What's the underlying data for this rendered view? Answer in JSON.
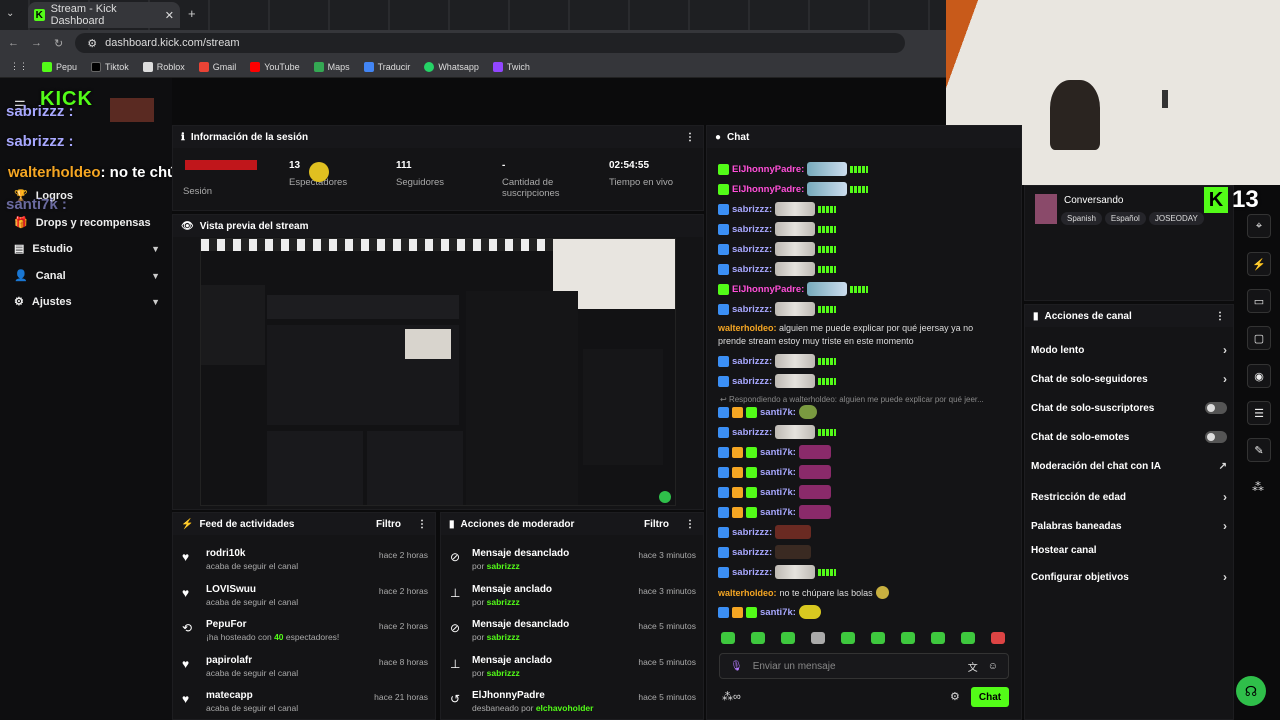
{
  "browser": {
    "tab_title": "Stream - Kick Dashboard",
    "url": "dashboard.kick.com/stream",
    "bookmarks": [
      "Pepu",
      "Tiktok",
      "Roblox",
      "Gmail",
      "YouTube",
      "Maps",
      "Traducir",
      "Whatsapp",
      "Twich"
    ]
  },
  "overlay": {
    "logo": "KICK",
    "lines": [
      {
        "user": "sabrizzz",
        "text": ":"
      },
      {
        "user": "sabrizzz",
        "text": ":"
      },
      {
        "user": "walterholdeo",
        "text": ": no te chúpare las bolas"
      },
      {
        "user": "santi7k",
        "text": ":"
      }
    ]
  },
  "sidebar": {
    "items": [
      {
        "label": "Logros"
      },
      {
        "label": "Drops y recompensas"
      },
      {
        "label": "Estudio"
      },
      {
        "label": "Canal"
      },
      {
        "label": "Ajustes"
      }
    ]
  },
  "session": {
    "title": "Información de la sesión",
    "stats": [
      {
        "value": "",
        "label": "Sesión"
      },
      {
        "value": "13",
        "label": "Espectadores"
      },
      {
        "value": "111",
        "label": "Seguidores"
      },
      {
        "value": "-",
        "label": "Cantidad de suscripciones"
      },
      {
        "value": "02:54:55",
        "label": "Tiempo en vivo"
      }
    ]
  },
  "preview": {
    "title": "Vista previa del stream"
  },
  "feed": {
    "title": "Feed de actividades",
    "filter": "Filtro",
    "items": [
      {
        "name": "rodri10k",
        "sub": "acaba de seguir el canal",
        "time": "hace 2 horas"
      },
      {
        "name": "LOVISwuu",
        "sub": "acaba de seguir el canal",
        "time": "hace 2 horas"
      },
      {
        "name": "PepuFor",
        "sub_pre": "¡ha hosteado con ",
        "sub_num": "40",
        "sub_post": " espectadores!",
        "time": "hace 2 horas"
      },
      {
        "name": "papirolafr",
        "sub": "acaba de seguir el canal",
        "time": "hace 8 horas"
      },
      {
        "name": "matecapp",
        "sub": "acaba de seguir el canal",
        "time": "hace 21 horas"
      }
    ]
  },
  "mod": {
    "title": "Acciones de moderador",
    "filter": "Filtro",
    "items": [
      {
        "action": "Mensaje desanclado",
        "by": "sabrizzz",
        "time": "hace 3 minutos"
      },
      {
        "action": "Mensaje anclado",
        "by": "sabrizzz",
        "time": "hace 3 minutos"
      },
      {
        "action": "Mensaje desanclado",
        "by": "sabrizzz",
        "time": "hace 5 minutos"
      },
      {
        "action": "Mensaje anclado",
        "by": "sabrizzz",
        "time": "hace 5 minutos"
      },
      {
        "action": "ElJhonnyPadre",
        "by": "elchavoholder",
        "by_pre": "desbaneado por ",
        "time": "hace 5 minutos"
      }
    ]
  },
  "chat": {
    "title": "Chat",
    "messages": [
      {
        "user": "ElJhonnyPadre:",
        "color": "#ff4fd8"
      },
      {
        "user": "ElJhonnyPadre:",
        "color": "#ff4fd8"
      },
      {
        "user": "sabrizzz:",
        "color": "#a8a8ff"
      },
      {
        "user": "sabrizzz:",
        "color": "#a8a8ff"
      },
      {
        "user": "sabrizzz:",
        "color": "#a8a8ff"
      },
      {
        "user": "sabrizzz:",
        "color": "#a8a8ff"
      },
      {
        "user": "ElJhonnyPadre:",
        "color": "#ff4fd8"
      },
      {
        "user": "sabrizzz:",
        "color": "#a8a8ff"
      }
    ],
    "long_msg": {
      "user": "walterholdeo:",
      "text": " alguien me puede explicar por qué jeersay ya no prende stream estoy muy triste en este momento"
    },
    "messages2": [
      {
        "user": "sabrizzz:"
      },
      {
        "user": "sabrizzz:"
      }
    ],
    "reply": "Respondiendo a walterholdeo: alguien me puede explicar por qué jeer...",
    "messages3": [
      {
        "user": "santi7k:"
      },
      {
        "user": "sabrizzz:"
      },
      {
        "user": "santi7k:"
      },
      {
        "user": "santi7k:"
      },
      {
        "user": "santi7k:"
      },
      {
        "user": "santi7k:"
      },
      {
        "user": "sabrizzz:"
      },
      {
        "user": "sabrizzz:"
      },
      {
        "user": "sabrizzz:"
      }
    ],
    "last_msg": {
      "user": "walterholdeo:",
      "text": " no te chúpare las bolas"
    },
    "final": {
      "user": "santi7k:"
    },
    "input_placeholder": "Enviar un mensaje",
    "send": "Chat"
  },
  "stream_info": {
    "category": "Conversando",
    "tags": [
      "Spanish",
      "Español",
      "JOSEODAY"
    ],
    "viewers": "13"
  },
  "channel_actions": {
    "title": "Acciones de canal",
    "items": [
      {
        "label": "Modo lento",
        "type": "chevron"
      },
      {
        "label": "Chat de solo-seguidores",
        "type": "chevron"
      },
      {
        "label": "Chat de solo-suscriptores",
        "type": "toggle"
      },
      {
        "label": "Chat de solo-emotes",
        "type": "toggle"
      },
      {
        "label": "Moderación del chat con IA",
        "type": "link"
      },
      {
        "label": "Restricción de edad",
        "type": "chevron"
      },
      {
        "label": "Palabras baneadas",
        "type": "chevron"
      },
      {
        "label": "Hostear canal",
        "type": "none"
      },
      {
        "label": "Configurar objetivos",
        "type": "chevron"
      }
    ]
  }
}
